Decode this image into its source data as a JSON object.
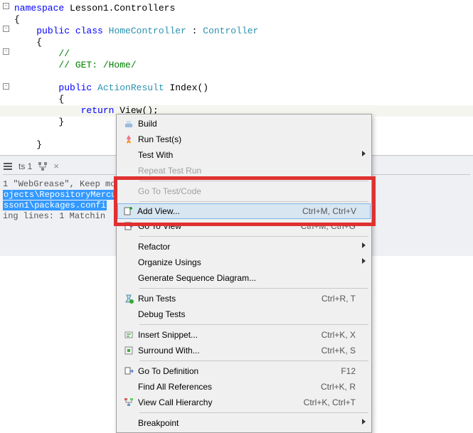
{
  "code": {
    "ns_kw": "namespace",
    "ns_name": " Lesson1.Controllers",
    "brace_open": "{",
    "class_kw": "public class",
    "class_name": " HomeController",
    "class_sep": " : ",
    "base": "Controller",
    "brace2": "    {",
    "comment1": "        //",
    "comment2": "        // GET: /Home/",
    "mkw": "public",
    "rtype": " ActionResult",
    "mname": " Index()",
    "brace3": "        {",
    "ret": "return",
    "view": " View();",
    "brace4": "        }",
    "brace5": "    }"
  },
  "tabs": {
    "t1": "ts 1"
  },
  "pane": {
    "line1a": "1 \"WebGrease\", Keep mo",
    "path": "ojects\\RepositoryMercu",
    "pathEnd": "sson1\\packages.confi",
    "line2": "ing lines: 1    Matchin"
  },
  "menu": {
    "build": "Build",
    "run_tests": "Run Test(s)",
    "test_with": "Test With",
    "repeat": "Repeat Test Run",
    "goto_code": "Go To Test/Code",
    "add_view": "Add View...",
    "add_view_sc": "Ctrl+M, Ctrl+V",
    "goto_view": "Go To View",
    "goto_view_sc": "Ctrl+M, Ctrl+G",
    "refactor": "Refactor",
    "organize": "Organize Usings",
    "gensd": "Generate Sequence Diagram...",
    "runtests2": "Run Tests",
    "runtests2_sc": "Ctrl+R, T",
    "debugtests": "Debug Tests",
    "insert": "Insert Snippet...",
    "insert_sc": "Ctrl+K, X",
    "surround": "Surround With...",
    "surround_sc": "Ctrl+K, S",
    "godef": "Go To Definition",
    "godef_sc": "F12",
    "findref": "Find All References",
    "findref_sc": "Ctrl+K, R",
    "callh": "View Call Hierarchy",
    "callh_sc": "Ctrl+K, Ctrl+T",
    "bp": "Breakpoint"
  }
}
